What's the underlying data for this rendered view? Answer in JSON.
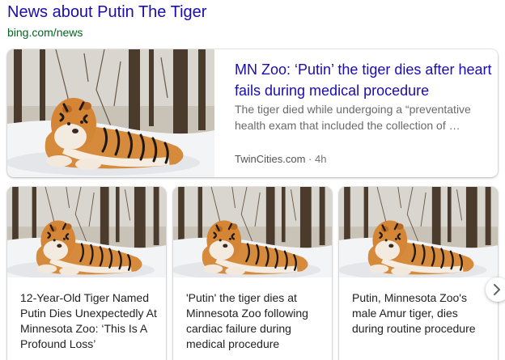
{
  "section": {
    "title": "News about Putin The Tiger",
    "source_url": "bing.com/news"
  },
  "main_article": {
    "headline": "MN Zoo: ‘Putin’ the tiger dies after heart fails during medical procedure",
    "snippet": "The tiger died while undergoing a “preventative health exam that included the collection of …",
    "publisher": "TwinCities.com",
    "separator": " · ",
    "age": "4h",
    "image": "tiger-in-snow-photo"
  },
  "articles": [
    {
      "headline": "12-Year-Old Tiger Named Putin Dies Unexpectedly At Minnesota Zoo: ‘This Is A Profound Loss’",
      "image": "tiger-in-snow-photo"
    },
    {
      "headline": "'Putin' the tiger dies at Minnesota Zoo following cardiac failure during medical procedure",
      "image": "tiger-in-snow-photo"
    },
    {
      "headline": "Putin, Minnesota Zoo's male Amur tiger, dies during routine procedure",
      "image": "tiger-in-snow-photo"
    }
  ],
  "carousel": {
    "next_icon": "chevron-right-icon"
  },
  "colors": {
    "link": "#1a0dab",
    "url": "#006621",
    "snippet": "#6a6a6a"
  }
}
